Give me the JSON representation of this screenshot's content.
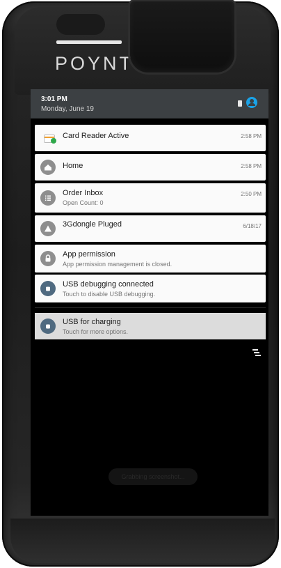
{
  "device": {
    "brand_logo": "POYNT"
  },
  "status_bar": {
    "time": "3:01 PM",
    "date": "Monday, June 19",
    "icons": [
      "sim-card-icon",
      "account-circle-icon"
    ],
    "accent_color": "#1aa3e8"
  },
  "notifications": [
    {
      "title": "Card Reader Active",
      "subtitle": "",
      "time": "2:58 PM",
      "icon": "card-reader-icon"
    },
    {
      "title": "Home",
      "subtitle": "",
      "time": "2:58 PM",
      "icon": "home-icon"
    },
    {
      "title": "Order Inbox",
      "subtitle": "Open Count: 0",
      "time": "2:50 PM",
      "icon": "list-icon"
    },
    {
      "title": "3Gdongle Pluged",
      "subtitle": "",
      "time": "6/18/17",
      "icon": "warning-icon"
    },
    {
      "title": "App permission",
      "subtitle": "App permission management is closed.",
      "time": "",
      "icon": "lock-icon"
    },
    {
      "title": "USB debugging connected",
      "subtitle": "Touch to disable USB debugging.",
      "time": "",
      "icon": "android-icon"
    }
  ],
  "ongoing": {
    "title": "USB for charging",
    "subtitle": "Touch for more options.",
    "icon": "android-icon"
  },
  "toast": "Grabbing screenshot...",
  "colors": {
    "card_bg": "#fafafa",
    "status_bar": "#3c4043",
    "icon_gray": "#8e8e8e",
    "icon_slate": "#4f6a80"
  }
}
